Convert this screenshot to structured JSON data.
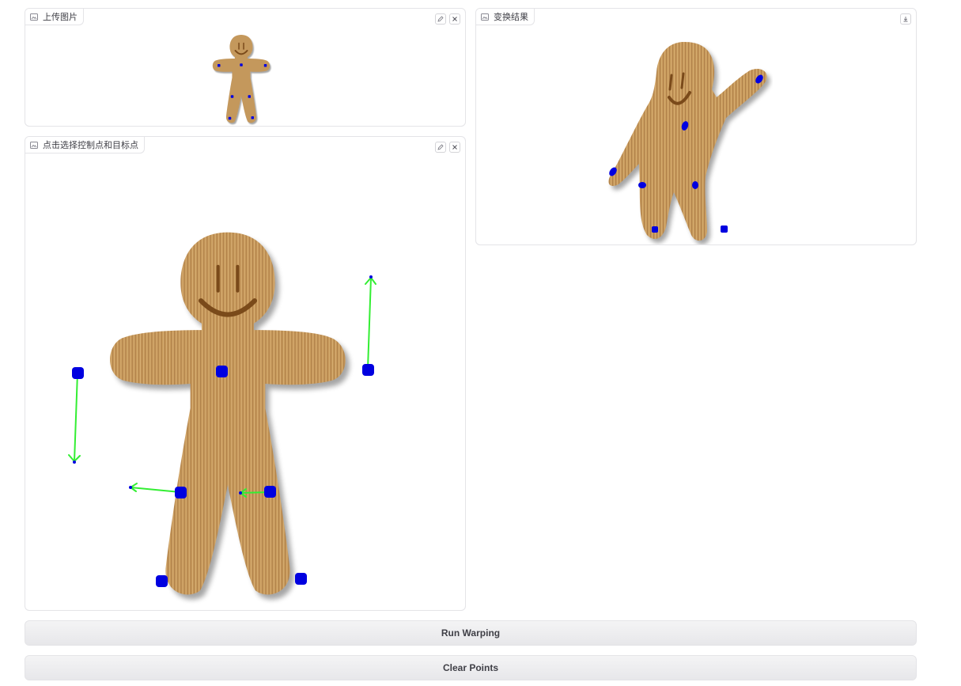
{
  "panels": {
    "upload": {
      "label": "上传图片"
    },
    "select": {
      "label": "点击选择控制点和目标点"
    },
    "result": {
      "label": "变换结果"
    }
  },
  "icons": {
    "image": "image-icon",
    "edit": "pencil-icon",
    "clear": "close-icon",
    "download": "download-icon"
  },
  "buttons": {
    "run": "Run Warping",
    "clear_points": "Clear Points"
  },
  "colors": {
    "control_point": "#0000e0",
    "arrow": "#33ee33",
    "wood_base": "#c99a5b"
  }
}
